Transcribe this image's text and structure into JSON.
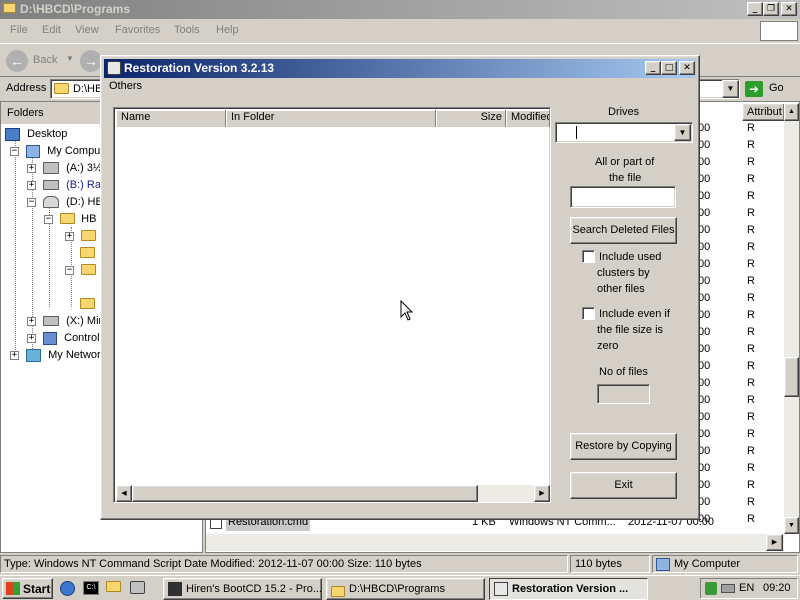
{
  "explorer": {
    "title": "D:\\HBCD\\Programs",
    "menu": [
      "File",
      "Edit",
      "View",
      "Favorites",
      "Tools",
      "Help"
    ],
    "back_label": "Back",
    "address_label": "Address",
    "address_value": "D:\\HB",
    "go_label": "Go",
    "folders_label": "Folders",
    "tree": [
      {
        "label": "Desktop"
      },
      {
        "label": "My Comput"
      },
      {
        "label": "(A:) 3½"
      },
      {
        "label": "(B:) Ran"
      },
      {
        "label": "(D:) HB"
      },
      {
        "label": "HB"
      },
      {
        "label": "(X:) Mir"
      },
      {
        "label": "Control"
      },
      {
        "label": "My Network"
      }
    ],
    "attrib_header": "Attribut",
    "attrib_values": [
      "R",
      "R",
      "R",
      "R",
      "R",
      "R",
      "R",
      "R",
      "R",
      "R",
      "R",
      "R",
      "R",
      "R",
      "R",
      "R",
      "R",
      "R",
      "R",
      "R",
      "R",
      "R",
      "R",
      "R"
    ],
    "size_col_values": [
      "00",
      "00",
      "00",
      "00",
      "00",
      "00",
      "00",
      "00",
      "00",
      "00",
      "00",
      "00",
      "00",
      "00",
      "00",
      "00",
      "00",
      "00",
      "00",
      "00",
      "00",
      "00",
      "00",
      "00"
    ],
    "partial_row": {
      "name": "Restoration.cmd",
      "size": "1 KB",
      "type": "Windows NT Comm...",
      "date": "2012-11-07 00:00"
    },
    "status_main": "Type: Windows NT Command Script Date Modified: 2012-11-07 00:00 Size: 110 bytes",
    "status_size": "110 bytes",
    "status_zone": "My Computer"
  },
  "dialog": {
    "title": "Restoration Version 3.2.13",
    "menu_others": "Others",
    "columns": [
      "Name",
      "In Folder",
      "Size",
      "Modified"
    ],
    "drives_label": "Drives",
    "drives_value": "",
    "search_label_line1": "All or part of",
    "search_label_line2": "the file",
    "search_value": "",
    "search_button": "Search Deleted Files",
    "include_used_label": [
      "Include used",
      "clusters by",
      "other files"
    ],
    "include_even_label": [
      "Include even if",
      "the file size is",
      "zero"
    ],
    "no_of_files_label": "No of files",
    "no_of_files_value": "",
    "restore_button": "Restore by Copying",
    "exit_button": "Exit"
  },
  "taskbar": {
    "start_label": "Start",
    "tasks": [
      {
        "label": "Hiren's BootCD 15.2 - Pro..."
      },
      {
        "label": "D:\\HBCD\\Programs"
      },
      {
        "label": "Restoration Version ..."
      }
    ],
    "lang": "EN",
    "time": "09:20"
  },
  "colors": {
    "title_active_start": "#0a246a",
    "title_active_end": "#a6caf0",
    "title_inactive": "#808080",
    "face": "#d4d0c8"
  }
}
